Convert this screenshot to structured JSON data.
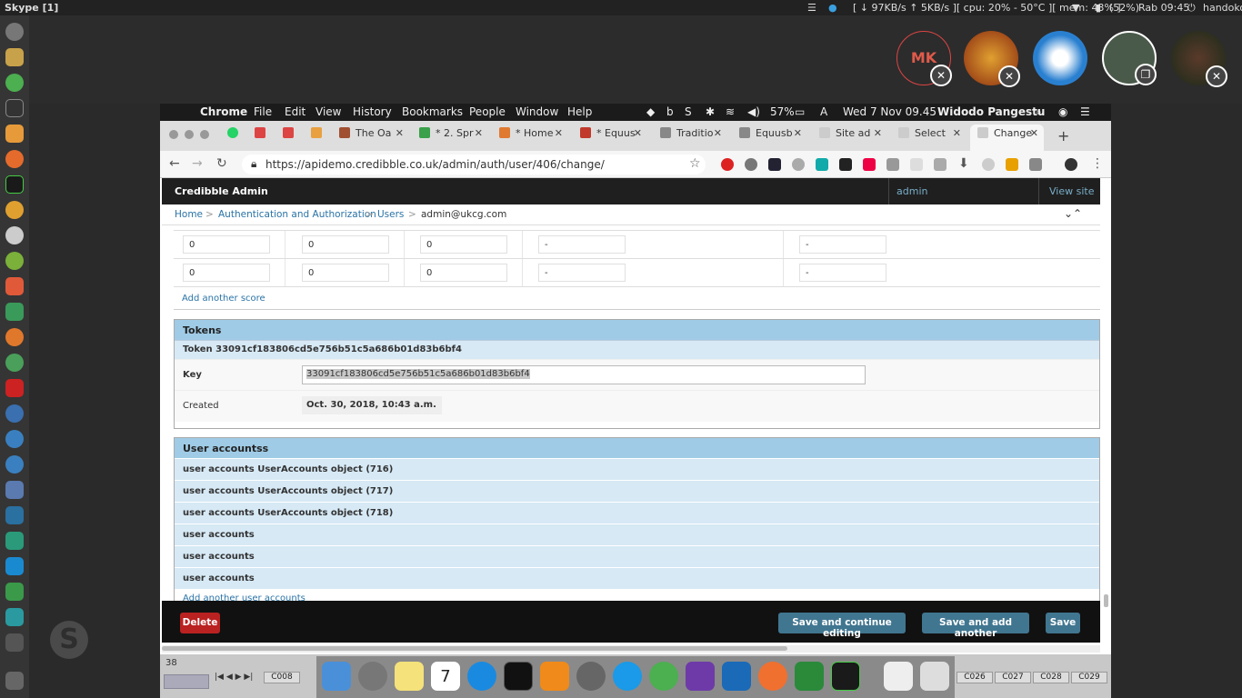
{
  "topbar": {
    "app": "Skype [1]",
    "net": "[ ↓  97KB/s ↑    5KB/s ][ cpu: 20% - 50°C ][ mem: 43% ]",
    "battery": "(52%)",
    "clock": "Rab 09:45",
    "user": "handoko"
  },
  "call": {
    "mk_initials": "MK"
  },
  "mac_menu": {
    "items": [
      "Chrome",
      "File",
      "Edit",
      "View",
      "History",
      "Bookmarks",
      "People",
      "Window",
      "Help"
    ],
    "battery": "57%",
    "datetime": "Wed 7 Nov  09.45",
    "user": "Widodo Pangestu"
  },
  "tabs": [
    "The Oa",
    "* 2. Spr",
    "* Home",
    "* Equus",
    "Traditio",
    "Equusb",
    "Site ad",
    "Select",
    "Change"
  ],
  "url": "https://apidemo.credibble.co.uk/admin/auth/user/406/change/",
  "admin": {
    "brand": "Credibble Admin",
    "user": "admin",
    "view_site": "View site"
  },
  "breadcrumb": {
    "home": "Home",
    "auth": "Authentication and Authorization",
    "users": "Users",
    "current": "admin@ukcg.com",
    "sep": ">"
  },
  "score_rows": [
    [
      "0",
      "0",
      "0",
      "-",
      "-"
    ],
    [
      "0",
      "0",
      "0",
      "-",
      "-"
    ]
  ],
  "add_score": "Add another score",
  "tokens": {
    "title": "Tokens",
    "token_line": "Token  33091cf183806cd5e756b51c5a686b01d83b6bf4",
    "key_label": "Key",
    "key_value": "33091cf183806cd5e756b51c5a686b01d83b6bf4",
    "created_label": "Created",
    "created_value": "Oct. 30, 2018, 10:43 a.m."
  },
  "user_accounts": {
    "title": "User accountss",
    "rows": [
      "user accounts  UserAccounts object (716)",
      "user accounts  UserAccounts object (717)",
      "user accounts  UserAccounts object (718)",
      "user accounts",
      "user accounts",
      "user accounts"
    ],
    "add": "Add another user accounts"
  },
  "buttons": {
    "delete": "Delete",
    "save_continue": "Save and continue editing",
    "save_add": "Save and add another",
    "save": "Save"
  },
  "sheet": {
    "row": "38",
    "tabs_left": [
      "C008"
    ],
    "tabs_right": [
      "C026",
      "C027",
      "C028",
      "C029"
    ]
  },
  "colors": {
    "header_blue": "#9fcbe6",
    "row_blue": "#d6e9f5",
    "link": "#2a73a6",
    "delete": "#ba2121",
    "save": "#417690"
  }
}
